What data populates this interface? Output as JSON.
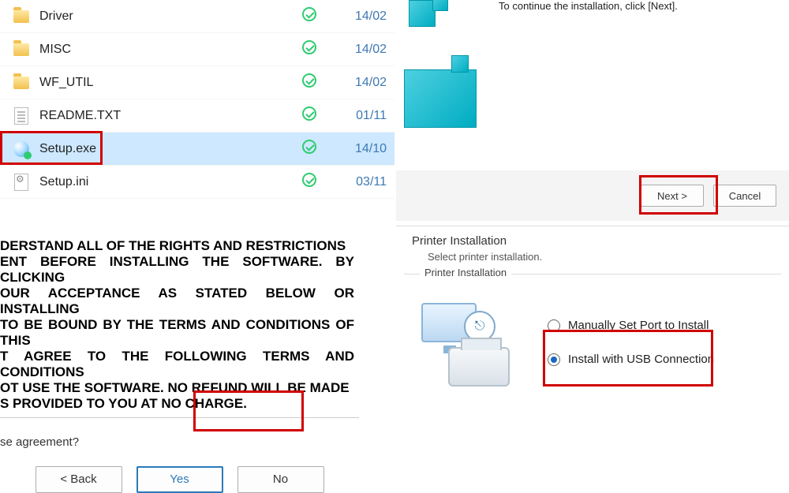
{
  "files": [
    {
      "name": "Driver",
      "type": "folder",
      "date": "14/02"
    },
    {
      "name": "MISC",
      "type": "folder",
      "date": "14/02"
    },
    {
      "name": "WF_UTIL",
      "type": "folder",
      "date": "14/02"
    },
    {
      "name": "README.TXT",
      "type": "txt",
      "date": "01/11"
    },
    {
      "name": "Setup.exe",
      "type": "exe",
      "date": "14/10",
      "selected": true
    },
    {
      "name": "Setup.ini",
      "type": "ini",
      "date": "03/11"
    }
  ],
  "welcome": {
    "instruction": "To continue the installation, click [Next].",
    "next_label": "Next >",
    "cancel_label": "Cancel"
  },
  "license": {
    "body": "DERSTAND  ALL  OF  THE  RIGHTS  AND  RESTRICTIONS\nENT BEFORE INSTALLING THE SOFTWARE.  BY CLICKING\nOUR ACCEPTANCE AS STATED BELOW OR INSTALLING\nTO BE BOUND BY THE TERMS AND CONDITIONS OF THIS\nT AGREE TO THE FOLLOWING TERMS AND CONDITIONS\nOT  USE  THE  SOFTWARE.    NO  REFUND  WILL  BE  MADE\nS PROVIDED TO YOU AT NO CHARGE.",
    "question": "se agreement?",
    "back_label": "< Back",
    "yes_label": "Yes",
    "no_label": "No"
  },
  "printer": {
    "title": "Printer Installation",
    "subtitle": "Select printer installation.",
    "group_label": "Printer Installation",
    "opt_manual": "Manually Set Port to Install",
    "opt_usb": "Install with USB Connection",
    "usb_selected": true
  }
}
